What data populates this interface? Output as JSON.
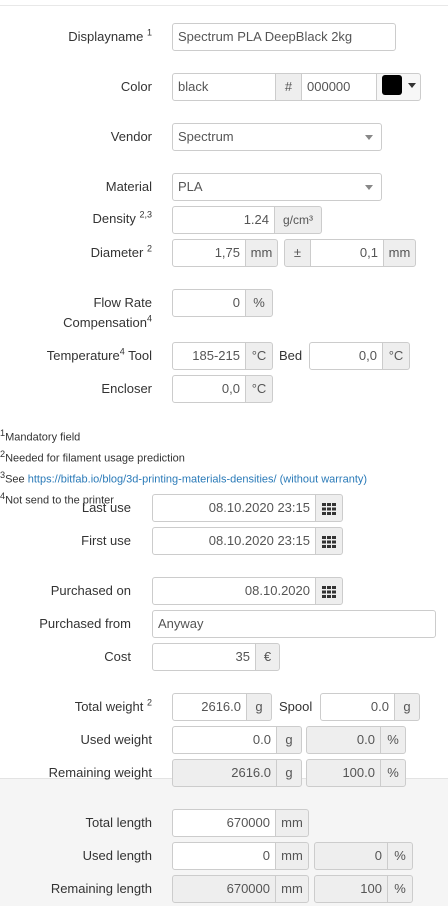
{
  "fields": {
    "displayname": {
      "label": "Displayname",
      "sup": "1",
      "value": "Spectrum PLA DeepBlack 2kg"
    },
    "color": {
      "label": "Color",
      "name_value": "black",
      "hash": "#",
      "hex_value": "000000",
      "swatch_color": "#000000"
    },
    "vendor": {
      "label": "Vendor",
      "value": "Spectrum"
    },
    "material": {
      "label": "Material",
      "value": "PLA"
    },
    "density": {
      "label": "Density",
      "sup": "2,3",
      "value": "1.24",
      "unit": "g/cm³"
    },
    "diameter": {
      "label": "Diameter",
      "sup": "2",
      "value": "1,75",
      "unit": "mm",
      "pm": "±",
      "tolerance": "0,1",
      "tol_unit": "mm"
    },
    "flow": {
      "label_line1": "Flow Rate",
      "label_line2": "Compensation",
      "sup": "4",
      "value": "0",
      "unit": "%"
    },
    "temperature": {
      "label": "Temperature",
      "sup": "4",
      "tool_label": "Tool",
      "tool_value": "185-215",
      "tool_unit": "°C",
      "bed_label": "Bed",
      "bed_value": "0,0",
      "bed_unit": "°C"
    },
    "encloser": {
      "label": "Encloser",
      "value": "0,0",
      "unit": "°C"
    }
  },
  "notes": {
    "n1": "Mandatory field",
    "n2": "Needed for filament usage prediction",
    "n3_prefix": "See ",
    "n3_link": "https://bitfab.io/blog/3d-printing-materials-densities/ (without warranty)",
    "n4": "Not send to the printer"
  },
  "usage": {
    "last_use": {
      "label": "Last use",
      "value": "08.10.2020 23:15"
    },
    "first_use": {
      "label": "First use",
      "value": "08.10.2020 23:15"
    }
  },
  "purchase": {
    "purchased_on": {
      "label": "Purchased on",
      "value": "08.10.2020"
    },
    "purchased_from": {
      "label": "Purchased from",
      "value": "Anyway"
    },
    "cost": {
      "label": "Cost",
      "value": "35",
      "unit": "€"
    }
  },
  "weight": {
    "total": {
      "label": "Total weight",
      "sup": "2",
      "value": "2616.0",
      "unit": "g",
      "spool_label": "Spool",
      "spool_value": "0.0",
      "spool_unit": "g"
    },
    "used": {
      "label": "Used weight",
      "value": "0.0",
      "unit": "g",
      "pct_value": "0.0",
      "pct_unit": "%"
    },
    "remaining": {
      "label": "Remaining weight",
      "value": "2616.0",
      "unit": "g",
      "pct_value": "100.0",
      "pct_unit": "%"
    }
  },
  "length": {
    "total": {
      "label": "Total length",
      "value": "670000",
      "unit": "mm"
    },
    "used": {
      "label": "Used length",
      "value": "0",
      "unit": "mm",
      "pct_value": "0",
      "pct_unit": "%"
    },
    "remaining": {
      "label": "Remaining length",
      "value": "670000",
      "unit": "mm",
      "pct_value": "100",
      "pct_unit": "%"
    }
  }
}
